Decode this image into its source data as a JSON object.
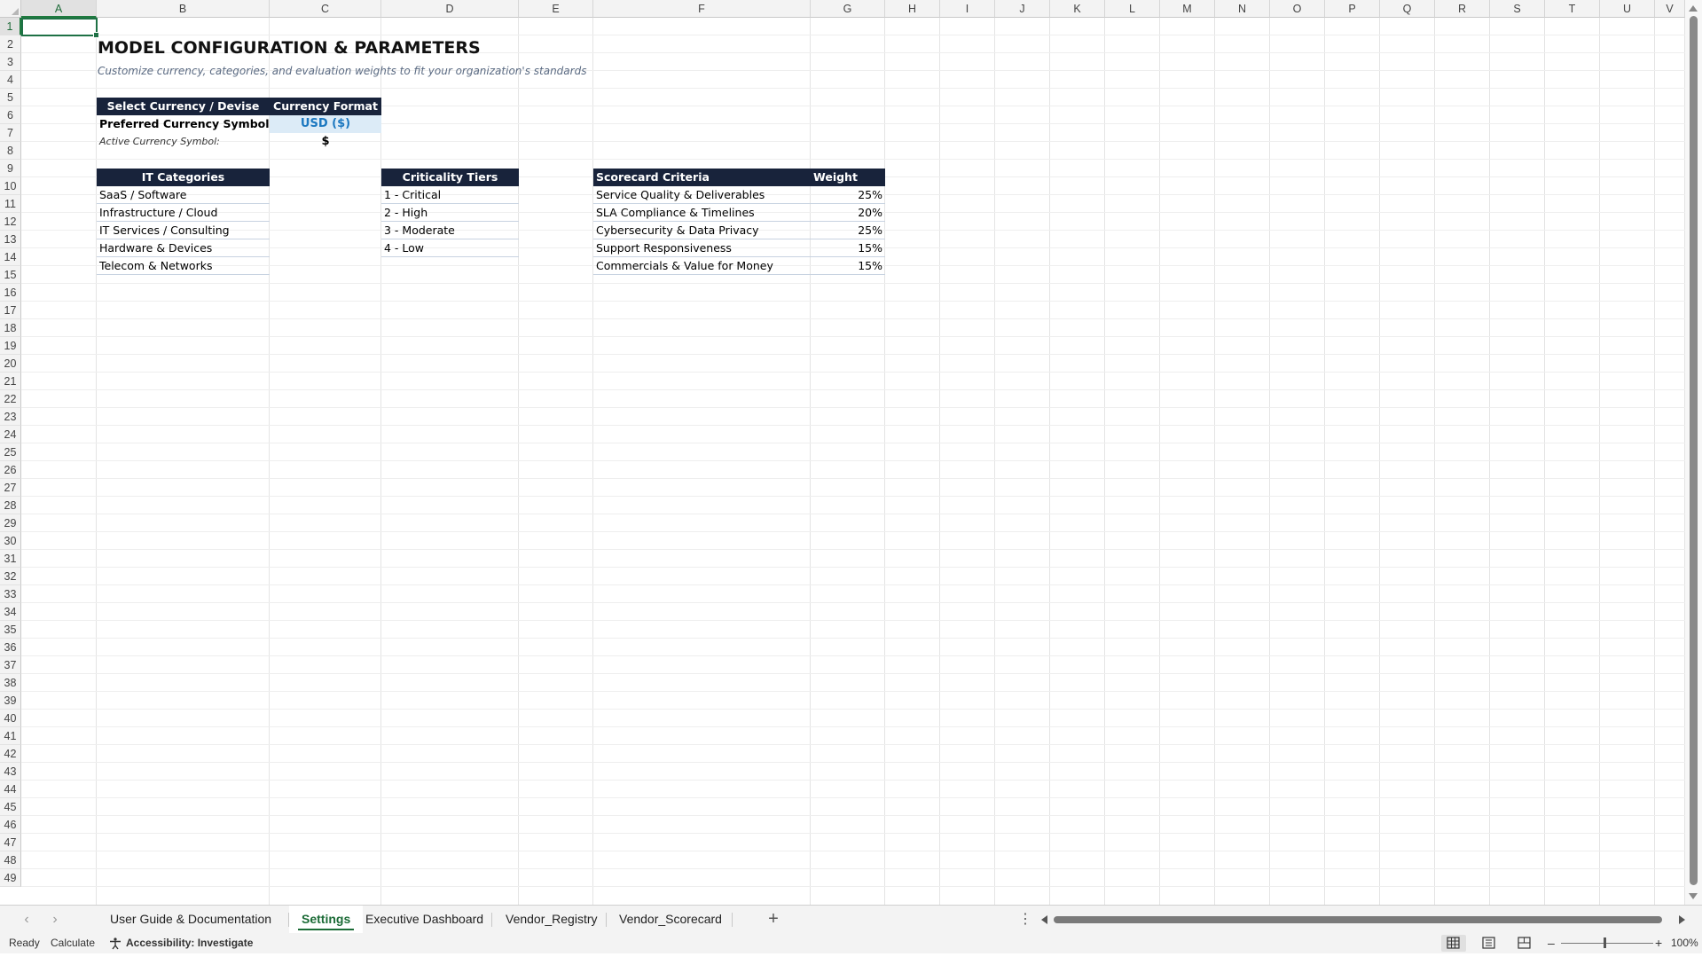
{
  "grid": {
    "columns": [
      "A",
      "B",
      "C",
      "D",
      "E",
      "F",
      "G",
      "H",
      "I",
      "J",
      "K",
      "L",
      "M",
      "N",
      "O",
      "P",
      "Q",
      "R",
      "S",
      "T",
      "U",
      "V"
    ],
    "rows": [
      "1",
      "2",
      "3",
      "4",
      "5",
      "6",
      "7",
      "8",
      "9",
      "10",
      "11",
      "12",
      "13",
      "14",
      "15",
      "16",
      "17",
      "18",
      "19",
      "20",
      "21",
      "22",
      "23",
      "24",
      "25",
      "26",
      "27",
      "28",
      "29",
      "30",
      "31",
      "32",
      "33",
      "34",
      "35",
      "36",
      "37",
      "38",
      "39",
      "40",
      "41",
      "42",
      "43",
      "44",
      "45",
      "46",
      "47",
      "48",
      "49"
    ],
    "active_cell": "A1"
  },
  "sheet": {
    "title": "MODEL CONFIGURATION & PARAMETERS",
    "subtitle": "Customize currency, categories, and evaluation weights to fit your organization's standards",
    "currency": {
      "header_select": "Select Currency / Devise",
      "header_format": "Currency Format",
      "preferred_label": "Preferred Currency Symbol:",
      "preferred_value": "USD ($)",
      "active_label": "Active Currency Symbol:",
      "active_value": "$"
    },
    "it_categories": {
      "header": "IT Categories",
      "items": [
        "SaaS / Software",
        "Infrastructure / Cloud",
        "IT Services / Consulting",
        "Hardware & Devices",
        "Telecom & Networks"
      ]
    },
    "criticality_tiers": {
      "header": "Criticality Tiers",
      "items": [
        "1 - Critical",
        "2 - High",
        "3 - Moderate",
        "4 - Low"
      ]
    },
    "scorecard": {
      "header_criteria": "Scorecard Criteria",
      "header_weight": "Weight",
      "rows": [
        {
          "criteria": "Service Quality & Deliverables",
          "weight": "25%"
        },
        {
          "criteria": "SLA Compliance & Timelines",
          "weight": "20%"
        },
        {
          "criteria": "Cybersecurity & Data Privacy",
          "weight": "25%"
        },
        {
          "criteria": "Support Responsiveness",
          "weight": "15%"
        },
        {
          "criteria": "Commercials & Value for Money",
          "weight": "15%"
        }
      ]
    }
  },
  "tabs": [
    {
      "label": "User Guide & Documentation",
      "active": false
    },
    {
      "label": "Settings",
      "active": true
    },
    {
      "label": "Executive Dashboard",
      "active": false
    },
    {
      "label": "Vendor_Registry",
      "active": false
    },
    {
      "label": "Vendor_Scorecard",
      "active": false
    }
  ],
  "status": {
    "ready": "Ready",
    "calculate": "Calculate",
    "accessibility": "Accessibility: Investigate",
    "zoom": "100%"
  },
  "colors": {
    "header_bg": "#18233b",
    "input_bg": "#dcebf7",
    "input_text": "#1c78c0",
    "accent_green": "#1b6b36"
  }
}
